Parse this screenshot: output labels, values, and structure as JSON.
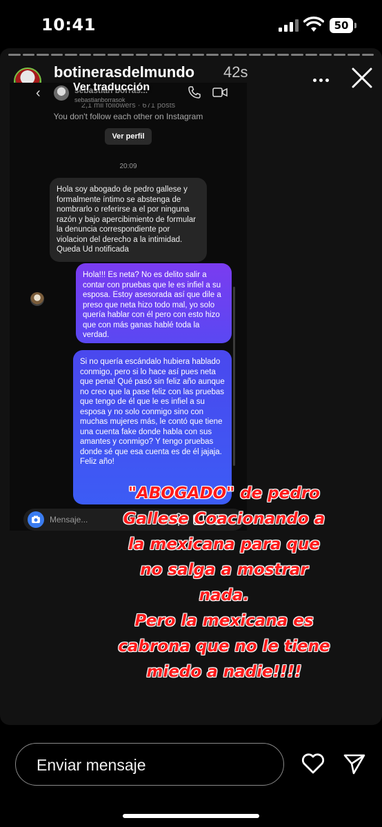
{
  "status_bar": {
    "time": "10:41",
    "battery": "50"
  },
  "story": {
    "username": "botinerasdelmundo",
    "time_ago": "42s",
    "progress_segments": 26
  },
  "embedded_chat": {
    "translation_link": "Ver traducción",
    "contact_name": "sebastian borras...",
    "contact_handle": "sebastianborrasok",
    "followers_line": "2,1 mil followers · 671 posts",
    "follow_status": "You don't follow each other on Instagram",
    "view_profile": "Ver perfil",
    "timestamp": "20:09",
    "incoming_message": "Hola soy abogado de pedro gallese y formalmente íntimo se abstenga de nombrarlo o referirse a el por ninguna razón y bajo apercibimiento de formular la denuncia correspondiente por violacion del derecho a la intimidad. Queda Ud notificada",
    "outgoing_message_1": "Hola!!! Es neta? No es delito salir a contar con pruebas que le es infiel a su esposa. Estoy asesorada así que dile a preso que neta hizo todo mal, yo solo quería hablar con él pero con esto hizo que con más ganas hablé toda la verdad.",
    "outgoing_message_2": "Si no quería escándalo hubiera hablado conmigo, pero si lo hace así pues neta que pena! Qué pasó sin feliz año aunque no creo que la pase feliz con las pruebas que tengo de él que le es infiel a su esposa y no solo conmigo sino con muchas mujeres más, le contó que tiene una cuenta fake donde habla con sus amantes y conmigo? Y tengo pruebas donde sé que esa cuenta es de él jajaja. Feliz año!",
    "composer_placeholder": "Mensaje..."
  },
  "caption": {
    "line1": "\"ABOGADO\" de pedro",
    "line2": "Gallese Coacionando a",
    "line3": "la mexicana para que",
    "line4": "no salga a mostrar",
    "line5": "nada.",
    "line6": "Pero la mexicana es",
    "line7": "cabrona que no le tiene",
    "line8": "miedo a nadie!!!!"
  },
  "reply_bar": {
    "placeholder": "Enviar mensaje"
  },
  "colors": {
    "caption_red": "#ff1a1a",
    "outgoing_top": "#7a3cf0",
    "outgoing_bottom": "#3c5cf5"
  }
}
